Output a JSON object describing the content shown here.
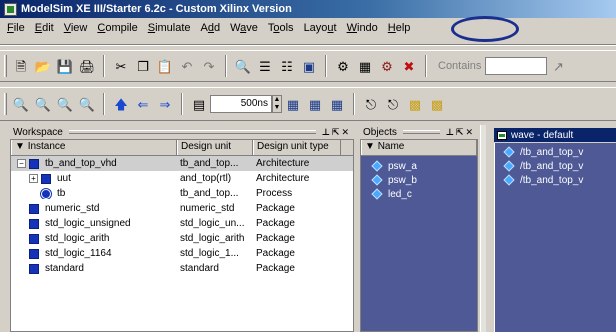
{
  "window": {
    "title": "ModelSim XE III/Starter 6.2c - Custom Xilinx Version"
  },
  "menu": [
    {
      "pre": "",
      "u": "F",
      "post": "ile"
    },
    {
      "pre": "",
      "u": "E",
      "post": "dit"
    },
    {
      "pre": "",
      "u": "V",
      "post": "iew"
    },
    {
      "pre": "",
      "u": "C",
      "post": "ompile"
    },
    {
      "pre": "",
      "u": "S",
      "post": "imulate"
    },
    {
      "pre": "A",
      "u": "d",
      "post": "d"
    },
    {
      "pre": "W",
      "u": "a",
      "post": "ve"
    },
    {
      "pre": "T",
      "u": "o",
      "post": "ols"
    },
    {
      "pre": "Layo",
      "u": "u",
      "post": "t"
    },
    {
      "pre": "",
      "u": "W",
      "post": "indo"
    },
    {
      "pre": "",
      "u": "H",
      "post": "elp"
    }
  ],
  "toolbar": {
    "contains_label": "Contains",
    "contains_value": "",
    "run_length": "500ns"
  },
  "workspace": {
    "title": "Workspace",
    "columns": [
      "Instance",
      "Design unit",
      "Design unit type"
    ],
    "rows": [
      {
        "instance": "tb_and_top_vhd",
        "unit": "tb_and_top...",
        "type": "Architecture",
        "expander": "−",
        "indent": 0,
        "icon": "square",
        "selected": true
      },
      {
        "instance": "uut",
        "unit": "and_top(rtl)",
        "type": "Architecture",
        "expander": "+",
        "indent": 1,
        "icon": "square",
        "selected": false
      },
      {
        "instance": "tb",
        "unit": "tb_and_top...",
        "type": "Process",
        "expander": "",
        "indent": 1,
        "icon": "process",
        "selected": false
      },
      {
        "instance": "numeric_std",
        "unit": "numeric_std",
        "type": "Package",
        "expander": "",
        "indent": 0,
        "icon": "square",
        "selected": false
      },
      {
        "instance": "std_logic_unsigned",
        "unit": "std_logic_un...",
        "type": "Package",
        "expander": "",
        "indent": 0,
        "icon": "square",
        "selected": false
      },
      {
        "instance": "std_logic_arith",
        "unit": "std_logic_arith",
        "type": "Package",
        "expander": "",
        "indent": 0,
        "icon": "square",
        "selected": false
      },
      {
        "instance": "std_logic_1164",
        "unit": "std_logic_1...",
        "type": "Package",
        "expander": "",
        "indent": 0,
        "icon": "square",
        "selected": false
      },
      {
        "instance": "standard",
        "unit": "standard",
        "type": "Package",
        "expander": "",
        "indent": 0,
        "icon": "square",
        "selected": false
      }
    ]
  },
  "objects": {
    "title": "Objects",
    "column": "Name",
    "signals": [
      "psw_a",
      "psw_b",
      "led_c"
    ]
  },
  "wave": {
    "title": "wave - default",
    "signals": [
      "/tb_and_top_v",
      "/tb_and_top_v",
      "/tb_and_top_v"
    ]
  },
  "colors": {
    "title_start": "#0a246a",
    "panel_blue": "#4e5996",
    "icon_blue": "#1433b8",
    "help_circle": "#1a2e8f"
  }
}
